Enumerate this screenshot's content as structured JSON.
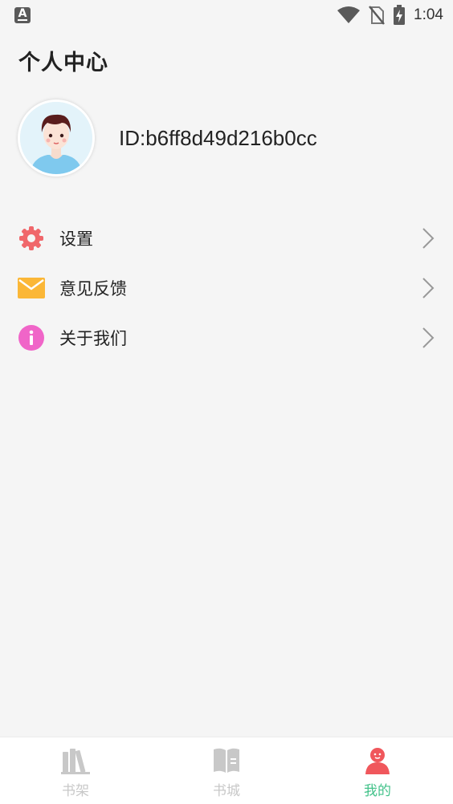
{
  "status_bar": {
    "time": "1:04",
    "ime_letter": "A"
  },
  "page": {
    "title": "个人中心"
  },
  "profile": {
    "user_id": "ID:b6ff8d49d216b0cc"
  },
  "menu": {
    "items": [
      {
        "label": "设置",
        "icon": "gear-icon",
        "color": "#f0676b"
      },
      {
        "label": "意见反馈",
        "icon": "mail-icon",
        "color": "#fbb737"
      },
      {
        "label": "关于我们",
        "icon": "info-icon",
        "color": "#f065c8"
      }
    ]
  },
  "tabbar": {
    "tabs": [
      {
        "label": "书架",
        "icon": "bookshelf-icon",
        "active": false
      },
      {
        "label": "书城",
        "icon": "open-book-icon",
        "active": false
      },
      {
        "label": "我的",
        "icon": "user-icon",
        "active": true
      }
    ],
    "active_color": "#43c28a",
    "inactive_color": "#c8c8c8"
  }
}
